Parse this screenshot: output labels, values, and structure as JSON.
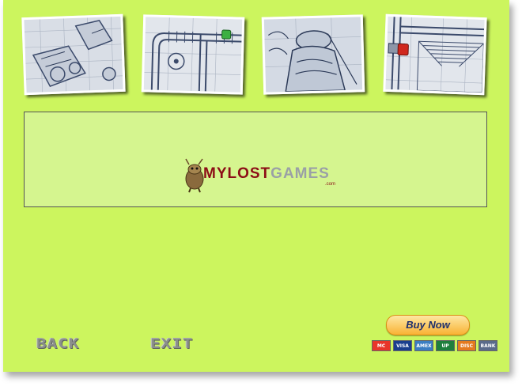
{
  "thumbnails": [
    {
      "name": "scene-sketch-locomotive"
    },
    {
      "name": "scene-sketch-rail-track-green-signal",
      "signal_color": "#3cb043"
    },
    {
      "name": "scene-sketch-robed-figure"
    },
    {
      "name": "scene-sketch-rail-track-red-signal",
      "signal_color": "#d0281e"
    }
  ],
  "ad": {
    "logo_part_my": "MYLOST",
    "logo_part_games": "GAMES",
    "logo_suffix": ".com"
  },
  "nav": {
    "back_label": "BACK",
    "exit_label": "EXIT"
  },
  "purchase": {
    "buy_now_label": "Buy Now",
    "cards": [
      {
        "label": "MC",
        "color": "#e8352a"
      },
      {
        "label": "VISA",
        "color": "#1a3e8e"
      },
      {
        "label": "AMEX",
        "color": "#3a7dc2"
      },
      {
        "label": "UP",
        "color": "#1e7f3d"
      },
      {
        "label": "DISC",
        "color": "#e57a1f"
      },
      {
        "label": "BANK",
        "color": "#5a6a8a"
      }
    ]
  }
}
